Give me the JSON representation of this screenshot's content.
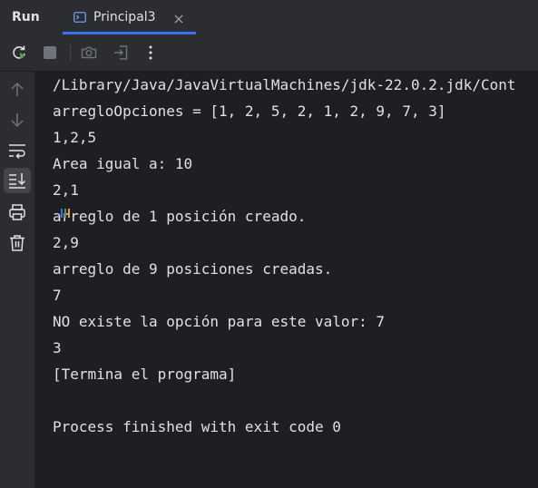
{
  "header": {
    "run_label": "Run",
    "tab": {
      "label": "Principal3",
      "icon": "console-icon",
      "close_icon": "close-icon"
    }
  },
  "toolbar": {
    "buttons": [
      {
        "name": "rerun-icon",
        "enabled": true
      },
      {
        "name": "stop-icon",
        "enabled": false
      },
      {
        "name": "camera-icon",
        "enabled": false
      },
      {
        "name": "exit-icon",
        "enabled": false
      },
      {
        "name": "more-options-icon",
        "enabled": true
      }
    ]
  },
  "sidebar": {
    "buttons": [
      {
        "name": "scroll-up-icon"
      },
      {
        "name": "scroll-down-icon"
      },
      {
        "name": "soft-wrap-icon"
      },
      {
        "name": "scroll-to-end-icon",
        "active": true
      },
      {
        "name": "print-icon"
      },
      {
        "name": "trash-icon"
      }
    ]
  },
  "console": {
    "lines": [
      "/Library/Java/JavaVirtualMachines/jdk-22.0.2.jdk/Cont",
      "arregloOpciones = [1, 2, 5, 2, 1, 2, 9, 7, 3]",
      "1,2,5",
      "Area igual a: 10",
      "2,1",
      "arreglo de 1 posición creado.",
      "2,9",
      "arreglo de 9 posiciones creadas.",
      "7",
      "NO existe la opción para este valor: 7",
      "3",
      "[Termina el programa]",
      "",
      "Process finished with exit code 0"
    ]
  },
  "colors": {
    "background": "#1e1f22",
    "panel": "#2b2d30",
    "text": "#dfe1e5",
    "accent": "#3574f0",
    "rerun_green": "#57965c"
  }
}
